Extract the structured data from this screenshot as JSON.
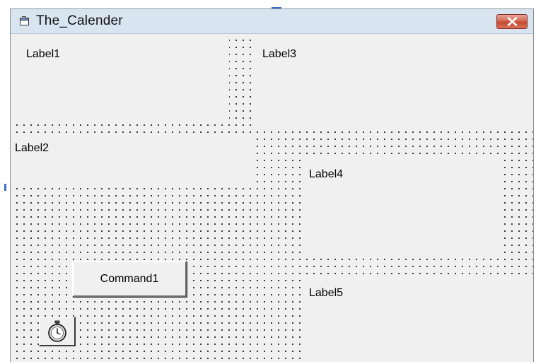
{
  "window": {
    "title": "The_Calender"
  },
  "labels": {
    "label1": "Label1",
    "label2": "Label2",
    "label3": "Label3",
    "label4": "Label4",
    "label5": "Label5"
  },
  "buttons": {
    "command1": "Command1"
  },
  "icons": {
    "title_icon": "form-icon",
    "close_icon": "close-icon",
    "timer_icon": "stopwatch-icon"
  },
  "colors": {
    "close_button": "#c9513a",
    "form_background": "#f0f0f0",
    "titlebar": "#d9e4f1"
  }
}
